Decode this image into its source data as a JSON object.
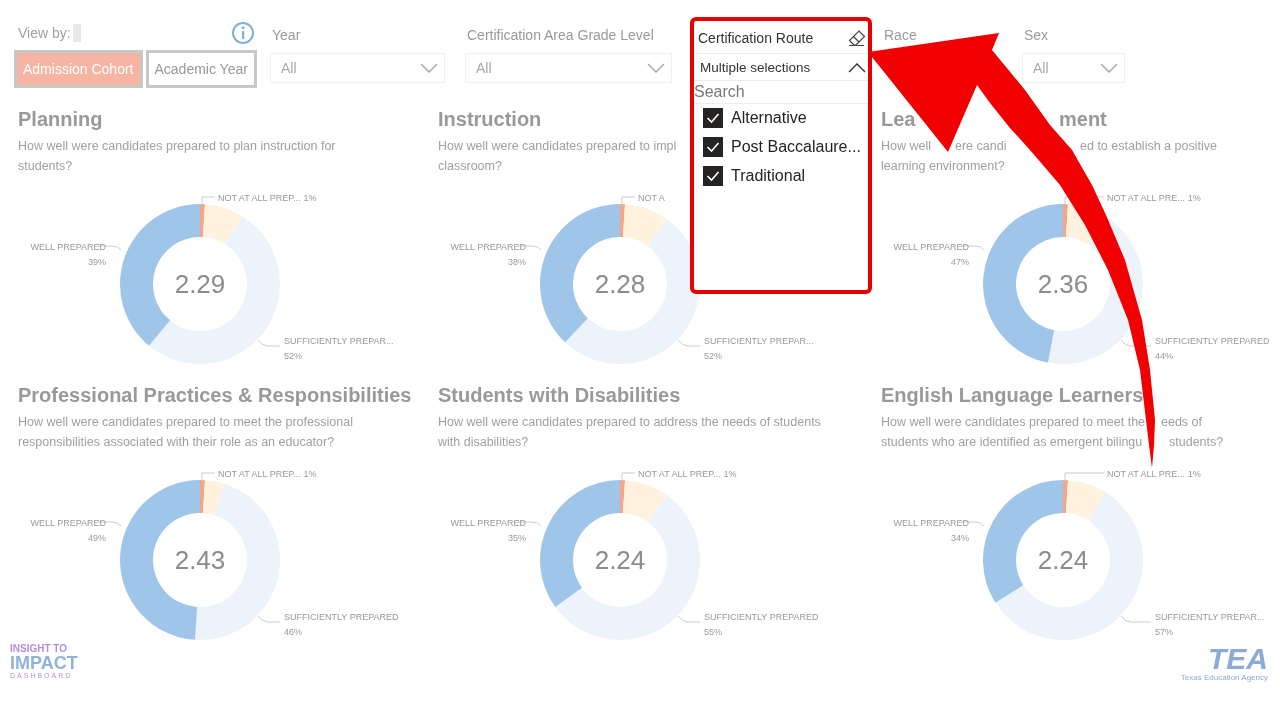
{
  "view_by": {
    "label": "View by:",
    "options": [
      {
        "label": "Admission Cohort",
        "selected": true
      },
      {
        "label": "Academic Year",
        "selected": false
      }
    ]
  },
  "filters": [
    {
      "kind": "dropdown",
      "label": "Year",
      "value": "All"
    },
    {
      "kind": "dropdown",
      "label": "Certification Area Grade Level",
      "value": "All"
    },
    {
      "kind": "slicer",
      "label": "Certification Route",
      "value": "Multiple selections",
      "expanded": true,
      "search": {
        "placeholder": "Search"
      },
      "items": [
        {
          "label": "Alternative",
          "checked": true
        },
        {
          "label": "Post Baccalaure...",
          "checked": true
        },
        {
          "label": "Traditional",
          "checked": true
        }
      ]
    },
    {
      "kind": "dropdown",
      "label": "Race"
    },
    {
      "kind": "dropdown",
      "label": "Sex",
      "value": "All"
    }
  ],
  "cards": [
    {
      "title": [
        "Planning"
      ],
      "subtitle_lines": [
        [
          "How well were candidates prepared to plan instruction for"
        ],
        [
          "students?"
        ]
      ],
      "chart_data": {
        "type": "donut",
        "annotations": [
          {
            "text": "2.29"
          }
        ],
        "categories": [
          "NOT AT ALL PREP...",
          null,
          "SUFFICIENTLY PREPAR...",
          "WELL PREPARED"
        ],
        "values": [
          1,
          8,
          52,
          39
        ],
        "value_labels": [
          "1%",
          null,
          "52%",
          "39%"
        ],
        "colors": [
          "#f4a58a",
          "#fff3e0",
          "#edf3fa",
          "#9fc5e8"
        ]
      }
    },
    {
      "title": [
        "Instruction"
      ],
      "subtitle_lines": [
        [
          "How well were candidates prepared to impl"
        ],
        [
          "classroom?"
        ]
      ],
      "chart_data": {
        "type": "donut",
        "annotations": [
          {
            "text": "2.28"
          }
        ],
        "categories": [
          "NOT A",
          null,
          "SUFFICIENTLY PREPAR...",
          "WELL PREPARED"
        ],
        "values": [
          1,
          9,
          52,
          38
        ],
        "value_labels": [
          null,
          null,
          "52%",
          "38%"
        ],
        "colors": [
          "#f4a58a",
          "#fff3e0",
          "#edf3fa",
          "#9fc5e8"
        ]
      }
    },
    {
      "title": [
        "Lea",
        "ment"
      ],
      "subtitle_lines": [
        [
          "How well",
          "ere candi",
          "ed to establish a positive"
        ],
        [
          "learning environment?"
        ]
      ],
      "chart_data": {
        "type": "donut",
        "annotations": [
          {
            "text": "2.36"
          }
        ],
        "categories": [
          "NOT AT ALL PRE...",
          null,
          "SUFFICIENTLY PREPARED",
          "WELL PREPARED"
        ],
        "values": [
          1,
          8,
          44,
          47
        ],
        "value_labels": [
          "1%",
          null,
          "44%",
          "47%"
        ],
        "colors": [
          "#f4a58a",
          "#fff3e0",
          "#edf3fa",
          "#9fc5e8"
        ]
      }
    },
    {
      "title": [
        "Professional Practices & Responsibilities"
      ],
      "subtitle_lines": [
        [
          "How well were candidates prepared to meet the professional"
        ],
        [
          "responsibilities associated with their role as an educator?"
        ]
      ],
      "chart_data": {
        "type": "donut",
        "annotations": [
          {
            "text": "2.43"
          }
        ],
        "categories": [
          "NOT AT ALL PREP...",
          null,
          "SUFFICIENTLY PREPARED",
          "WELL PREPARED"
        ],
        "values": [
          1,
          4,
          46,
          49
        ],
        "value_labels": [
          "1%",
          null,
          "46%",
          "49%"
        ],
        "colors": [
          "#f4a58a",
          "#fff3e0",
          "#edf3fa",
          "#9fc5e8"
        ]
      }
    },
    {
      "title": [
        "Students with Disabilities"
      ],
      "subtitle_lines": [
        [
          "How well were candidates prepared to address the needs of students"
        ],
        [
          "with disabilities?"
        ]
      ],
      "chart_data": {
        "type": "donut",
        "annotations": [
          {
            "text": "2.24"
          }
        ],
        "categories": [
          "NOT AT ALL PREP...",
          null,
          "SUFFICIENTLY PREPARED",
          "WELL PREPARED"
        ],
        "values": [
          1,
          9,
          55,
          35
        ],
        "value_labels": [
          "1%",
          null,
          "55%",
          "35%"
        ],
        "colors": [
          "#f4a58a",
          "#fff3e0",
          "#edf3fa",
          "#9fc5e8"
        ]
      }
    },
    {
      "title": [
        "English Language Learners"
      ],
      "subtitle_lines": [
        [
          "How well were candidates prepared to meet the",
          "eeds of"
        ],
        [
          "students who are identified as emergent bilingu",
          "students?"
        ]
      ],
      "chart_data": {
        "type": "donut",
        "annotations": [
          {
            "text": "2.24"
          }
        ],
        "categories": [
          "NOT AT ALL PRE...",
          null,
          "SUFFICIENTLY PREPAR...",
          "WELL PREPARED"
        ],
        "values": [
          1,
          8,
          57,
          34
        ],
        "value_labels": [
          "1%",
          null,
          "57%",
          "34%"
        ],
        "colors": [
          "#f4a58a",
          "#fff3e0",
          "#edf3fa",
          "#9fc5e8"
        ]
      }
    }
  ],
  "footer": {
    "left_logo": [
      "INSIGHT TO",
      "IMPACT",
      "DASHBOARD"
    ],
    "right_logo": [
      "TEA",
      "Texas Education Agency"
    ]
  }
}
